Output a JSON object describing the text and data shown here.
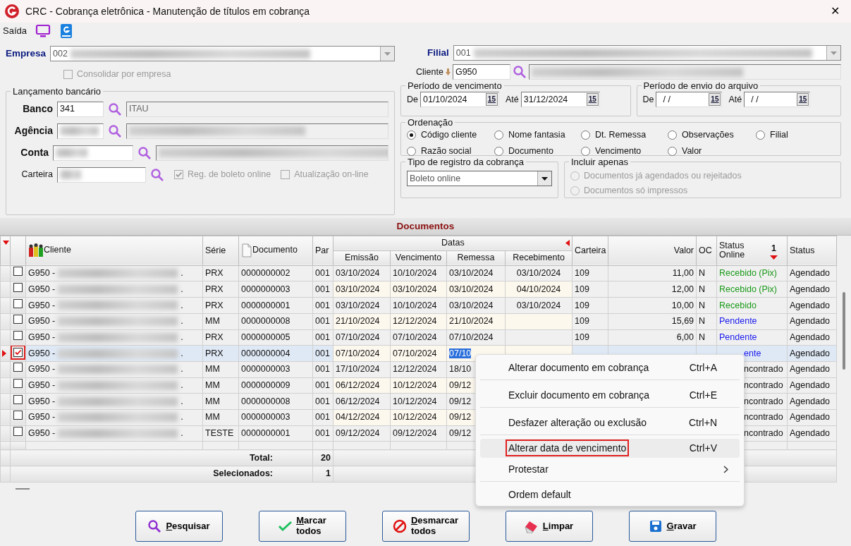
{
  "window": {
    "title": "CRC - Cobrança eletrônica - Manutenção de títulos em cobrança",
    "close": "✕"
  },
  "toolbar": {
    "label": "Saída"
  },
  "empresa": {
    "label": "Empresa",
    "value": "002"
  },
  "consolidar": {
    "label": "Consolidar por empresa",
    "checked": false,
    "disabled": true
  },
  "filial": {
    "label": "Filial",
    "value": "001"
  },
  "cliente": {
    "label": "Cliente",
    "value": "G950"
  },
  "lancamento": {
    "title": "Lançamento bancário",
    "fields": [
      {
        "label": "Banco",
        "value": "341",
        "description": "ITAU",
        "bold": true
      },
      {
        "label": "Agência",
        "bold": true
      },
      {
        "label": "Conta",
        "bold": true
      },
      {
        "label": "Carteira",
        "bold": false
      }
    ],
    "checks": [
      {
        "label": "Reg. de boleto online",
        "checked": true,
        "disabled": true
      },
      {
        "label": "Atualização on-line",
        "checked": false,
        "disabled": true
      }
    ]
  },
  "periodos": [
    {
      "title": "Período de vencimento",
      "from_label": "De",
      "from": "01/10/2024",
      "to_label": "Até",
      "to": "31/12/2024",
      "from_button": "15",
      "to_button": "15"
    },
    {
      "title": "Período de envio do arquivo",
      "from_label": "De",
      "from": "/ /",
      "to_label": "Até",
      "to": "/ /",
      "from_button": "15",
      "to_button": "15"
    }
  ],
  "ordenacao": {
    "title": "Ordenação",
    "options": [
      {
        "label": "Código cliente",
        "selected": true
      },
      {
        "label": "Nome fantasia",
        "selected": false
      },
      {
        "label": "Dt. Remessa",
        "selected": false
      },
      {
        "label": "Observações",
        "selected": false
      },
      {
        "label": "Filial",
        "selected": false
      },
      {
        "label": "Razão social",
        "selected": false
      },
      {
        "label": "Documento",
        "selected": false
      },
      {
        "label": "Vencimento",
        "selected": false
      },
      {
        "label": "Valor",
        "selected": false
      }
    ]
  },
  "tipo_registro": {
    "title": "Tipo de registro da cobrança",
    "value": "Boleto online"
  },
  "incluir": {
    "title": "Incluir apenas",
    "options": [
      {
        "label": "Documentos já agendados ou rejeitados",
        "selected": false,
        "disabled": true
      },
      {
        "label": "Documentos só impressos",
        "selected": false,
        "disabled": true
      }
    ]
  },
  "documentos": {
    "title": "Documentos"
  },
  "table": {
    "group_header": "Datas",
    "sort_order": "1",
    "columns": [
      "Cliente",
      "Série",
      "Documento",
      "Par",
      "Emissão",
      "Vencimento",
      "Remessa",
      "Recebimento",
      "Carteira",
      "Valor",
      "OC",
      "Status Online",
      "Status"
    ],
    "rows": [
      {
        "checked": false,
        "selected": false,
        "highlighted": false,
        "cliente": "G950 -",
        "cliente_tail": ".",
        "serie": "PRX",
        "documento": "0000000002",
        "par": "001",
        "emissao": "03/10/2024",
        "vencimento": "10/10/2024",
        "remessa": "03/10/2024",
        "recebimento": "03/10/2024",
        "carteira": "109",
        "valor": "11,00",
        "oc": "N",
        "status_online": "Recebido (Pix)",
        "color": "#1a9a1a",
        "status": "Agendado"
      },
      {
        "checked": false,
        "selected": false,
        "highlighted": false,
        "cliente": "G950 -",
        "cliente_tail": ".",
        "serie": "PRX",
        "documento": "0000000003",
        "par": "001",
        "emissao": "03/10/2024",
        "vencimento": "03/10/2024",
        "remessa": "03/10/2024",
        "recebimento": "04/10/2024",
        "carteira": "109",
        "valor": "12,00",
        "oc": "N",
        "status_online": "Recebido (Pix)",
        "color": "#1a9a1a",
        "status": "Agendado"
      },
      {
        "checked": false,
        "selected": false,
        "highlighted": false,
        "cliente": "G950 -",
        "cliente_tail": ".",
        "serie": "PRX",
        "documento": "0000000001",
        "par": "001",
        "emissao": "03/10/2024",
        "vencimento": "10/10/2024",
        "remessa": "03/10/2024",
        "recebimento": "03/10/2024",
        "carteira": "109",
        "valor": "10,00",
        "oc": "N",
        "status_online": "Recebido",
        "color": "#1a9a1a",
        "status": "Agendado"
      },
      {
        "checked": false,
        "selected": false,
        "highlighted": false,
        "cliente": "G950 -",
        "cliente_tail": ".",
        "serie": "MM",
        "documento": "0000000008",
        "par": "001",
        "emissao": "21/10/2024",
        "vencimento": "12/12/2024",
        "remessa": "21/10/2024",
        "carteira": "109",
        "valor": "15,69",
        "oc": "N",
        "status_online": "Pendente",
        "color": "#1a1aee",
        "status": "Agendado"
      },
      {
        "checked": false,
        "selected": false,
        "highlighted": false,
        "cliente": "G950 -",
        "cliente_tail": ".",
        "serie": "PRX",
        "documento": "0000000005",
        "par": "001",
        "emissao": "07/10/2024",
        "vencimento": "07/10/2024",
        "remessa": "07/10/2024",
        "carteira": "109",
        "valor": "6,00",
        "oc": "N",
        "status_online": "Pendente",
        "color": "#1a1aee",
        "status": "Agendado"
      },
      {
        "checked": true,
        "selected": true,
        "highlighted": true,
        "cliente": "G950 -",
        "cliente_tail": ".",
        "serie": "PRX",
        "documento": "0000000004",
        "par": "001",
        "emissao": "07/10/2024",
        "vencimento": "07/10/2024",
        "remessa": "07/10",
        "status_online": "ente",
        "color": "#1a1aee",
        "status": "Agendado"
      },
      {
        "checked": false,
        "selected": false,
        "highlighted": false,
        "cliente": "G950 -",
        "cliente_tail": ".",
        "serie": "MM",
        "documento": "0000000003",
        "par": "001",
        "emissao": "17/10/2024",
        "vencimento": "12/12/2024",
        "remessa": "18/10",
        "status_online": "ncontrado",
        "color": "#111111",
        "status": "Agendado"
      },
      {
        "checked": false,
        "selected": false,
        "highlighted": false,
        "cliente": "G950 -",
        "cliente_tail": ".",
        "serie": "MM",
        "documento": "0000000009",
        "par": "001",
        "emissao": "06/12/2024",
        "vencimento": "10/12/2024",
        "remessa": "09/12",
        "status_online": "ncontrado",
        "color": "#111111",
        "status": "Agendado"
      },
      {
        "checked": false,
        "selected": false,
        "highlighted": false,
        "cliente": "G950 -",
        "cliente_tail": ".",
        "serie": "MM",
        "documento": "0000000008",
        "par": "001",
        "emissao": "06/12/2024",
        "vencimento": "10/12/2024",
        "remessa": "09/12",
        "status_online": "ncontrado",
        "color": "#111111",
        "status": "Agendado"
      },
      {
        "checked": false,
        "selected": false,
        "highlighted": false,
        "cliente": "G950 -",
        "cliente_tail": ".",
        "serie": "MM",
        "documento": "0000000003",
        "par": "001",
        "emissao": "04/12/2024",
        "vencimento": "10/12/2024",
        "remessa": "09/12",
        "status_online": "ncontrado",
        "color": "#111111",
        "status": "Agendado"
      },
      {
        "checked": false,
        "selected": false,
        "highlighted": false,
        "cliente": "G950 -",
        "cliente_tail": ".",
        "serie": "TESTE",
        "documento": "0000000001",
        "par": "001",
        "emissao": "09/12/2024",
        "vencimento": "09/12/2024",
        "remessa": "09/12",
        "status_online": "ncontrado",
        "color": "#111111",
        "status": "Agendado"
      }
    ],
    "totals": [
      {
        "label": "Total:",
        "value": "20"
      },
      {
        "label": "Selecionados:",
        "value": "1"
      }
    ]
  },
  "context_menu": [
    {
      "label": "Alterar documento em cobrança",
      "shortcut": "Ctrl+A",
      "kind": "item",
      "highlighted": false,
      "separator_after": true
    },
    {
      "label": "Excluir documento em cobrança",
      "shortcut": "Ctrl+E",
      "kind": "item",
      "highlighted": false,
      "separator_after": true
    },
    {
      "label": "Desfazer alteração ou exclusão",
      "shortcut": "Ctrl+N",
      "kind": "item",
      "highlighted": false,
      "separator_after": true
    },
    {
      "label": "Alterar data de vencimento",
      "shortcut": "Ctrl+V",
      "kind": "item",
      "highlighted": true,
      "separator_after": false
    },
    {
      "label": "Protestar",
      "kind": "submenu",
      "highlighted": false,
      "separator_after": true
    },
    {
      "label": "Ordem default",
      "kind": "item",
      "highlighted": false,
      "separator_after": false
    }
  ],
  "buttons": [
    {
      "lines": [
        "Pesquisar"
      ],
      "kind": "search"
    },
    {
      "lines": [
        "Marcar",
        "todos"
      ],
      "kind": "check"
    },
    {
      "lines": [
        "Desmarcar",
        "todos"
      ],
      "kind": "cancel"
    },
    {
      "lines": [
        "Limpar"
      ],
      "kind": "eraser"
    },
    {
      "lines": [
        "Gravar"
      ],
      "kind": "save"
    }
  ]
}
